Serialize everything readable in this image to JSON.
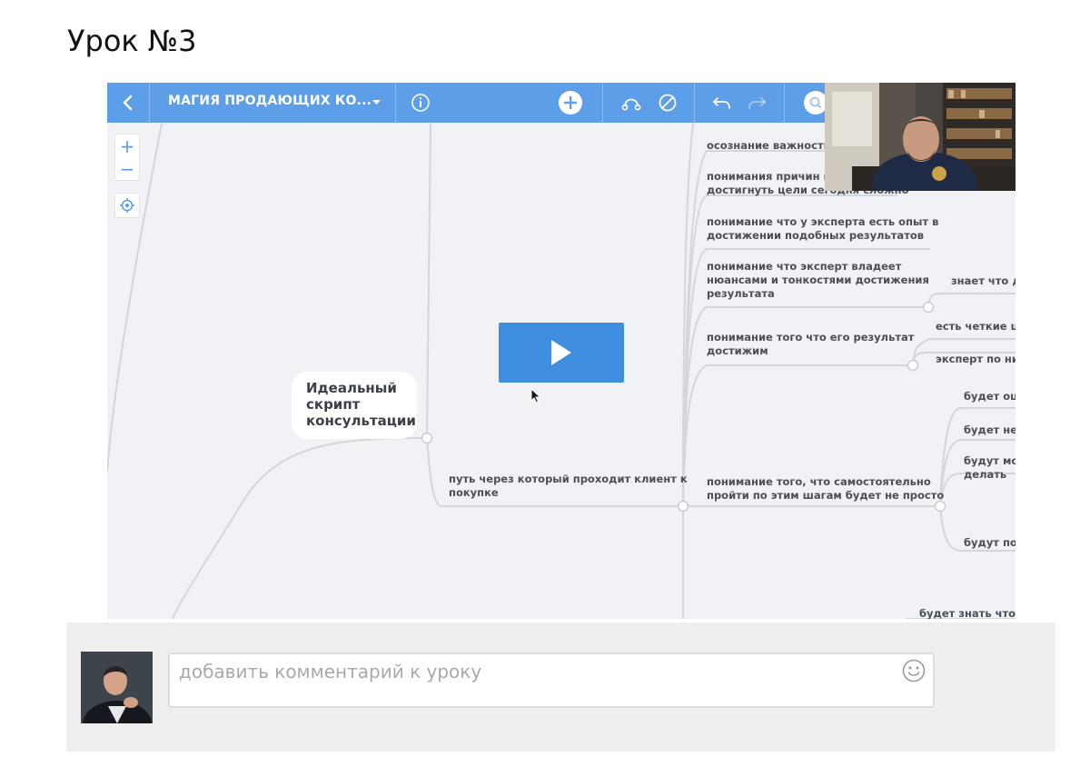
{
  "lesson": {
    "title": "Урок №3"
  },
  "mindmap": {
    "toolbar": {
      "title": "МАГИЯ ПРОДАЮЩИХ КО..."
    },
    "center_node": {
      "line1": "Идеальный",
      "line2": "скрипт",
      "line3": "консультации"
    },
    "branch": {
      "line1": "путь через который проходит клиент к",
      "line2": "покупке"
    },
    "nodes": [
      {
        "line1": "осознание важности",
        "line2": ""
      },
      {
        "line1": "понимания причин по",
        "line2": "достигнуть цели сегодня сложно"
      },
      {
        "line1": "понимание что у эксперта есть опыт в",
        "line2": "достижении подобных результатов"
      },
      {
        "line1": "понимание что эксперт владеет",
        "line2": "нюансами и тонкостями достижения",
        "line3": "результата"
      },
      {
        "line1": "понимание того что его результат",
        "line2": "достижим"
      },
      {
        "line1": "понимание того, что самостоятельно",
        "line2": "пройти по этим шагам будет не просто"
      }
    ],
    "sub_nodes": [
      "знает что де",
      "есть четкие ша",
      "эксперт по ни",
      "будет ош",
      "будет не",
      "будут мо",
      "делать",
      "будут пот",
      "будет знать что д"
    ]
  },
  "comments": {
    "placeholder": "добавить комментарий к уроку"
  },
  "icons": {
    "back": "chevron-left-icon",
    "dropdown": "caret-down-icon",
    "info": "info-icon",
    "add": "plus-circle-icon",
    "connect": "connection-icon",
    "disable": "slash-circle-icon",
    "undo": "undo-icon",
    "redo": "redo-icon",
    "search": "search-icon",
    "zoom_in": "plus-icon",
    "zoom_out": "minus-icon",
    "locate": "target-icon",
    "play": "play-icon",
    "emoji": "smiley-icon"
  },
  "colors": {
    "toolbar": "#5d9ee8",
    "canvas": "#f0f2f5",
    "play": "#3f8ee0",
    "comment_bg": "#eeeeee"
  }
}
